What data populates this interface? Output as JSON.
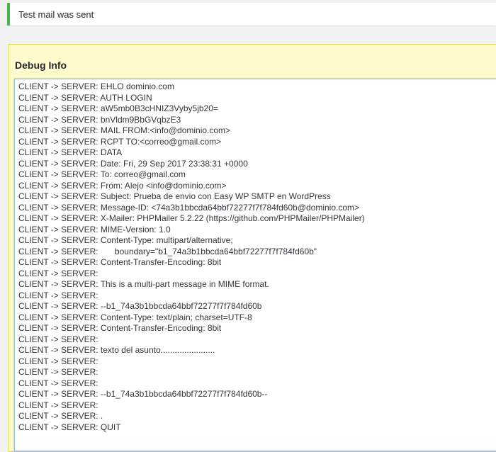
{
  "notice": {
    "message": "Test mail was sent"
  },
  "debug": {
    "title": "Debug Info",
    "lines": [
      "CLIENT -> SERVER: EHLO dominio.com",
      "CLIENT -> SERVER: AUTH LOGIN",
      "CLIENT -> SERVER: aW5mb0B3cHNIZ3Vyby5jb20=",
      "CLIENT -> SERVER: bnVldm9BbGVqbzE3",
      "CLIENT -> SERVER: MAIL FROM:<info@dominio.com>",
      "CLIENT -> SERVER: RCPT TO:<correo@gmail.com>",
      "CLIENT -> SERVER: DATA",
      "CLIENT -> SERVER: Date: Fri, 29 Sep 2017 23:38:31 +0000",
      "CLIENT -> SERVER: To: correo@gmail.com",
      "CLIENT -> SERVER: From: Alejo <info@dominio.com>",
      "CLIENT -> SERVER: Subject: Prueba de envio con Easy WP SMTP en WordPress",
      "CLIENT -> SERVER: Message-ID: <74a3b1bbcda64bbf72277f7f784fd60b@dominio.com>",
      "CLIENT -> SERVER: X-Mailer: PHPMailer 5.2.22 (https://github.com/PHPMailer/PHPMailer)",
      "CLIENT -> SERVER: MIME-Version: 1.0",
      "CLIENT -> SERVER: Content-Type: multipart/alternative;",
      "CLIENT -> SERVER:       boundary=\"b1_74a3b1bbcda64bbf72277f7f784fd60b\"",
      "CLIENT -> SERVER: Content-Transfer-Encoding: 8bit",
      "CLIENT -> SERVER:",
      "CLIENT -> SERVER: This is a multi-part message in MIME format.",
      "CLIENT -> SERVER:",
      "CLIENT -> SERVER: --b1_74a3b1bbcda64bbf72277f7f784fd60b",
      "CLIENT -> SERVER: Content-Type: text/plain; charset=UTF-8",
      "CLIENT -> SERVER: Content-Transfer-Encoding: 8bit",
      "CLIENT -> SERVER:",
      "CLIENT -> SERVER: texto del asunto.......................",
      "CLIENT -> SERVER:",
      "CLIENT -> SERVER:",
      "CLIENT -> SERVER:",
      "CLIENT -> SERVER: --b1_74a3b1bbcda64bbf72277f7f784fd60b--",
      "CLIENT -> SERVER:",
      "CLIENT -> SERVER: .",
      "CLIENT -> SERVER: QUIT"
    ]
  },
  "colors": {
    "notice_accent": "#46b450",
    "panel_background": "#fffbcc",
    "panel_border": "#e6db55",
    "log_border": "#9bbfd4"
  }
}
